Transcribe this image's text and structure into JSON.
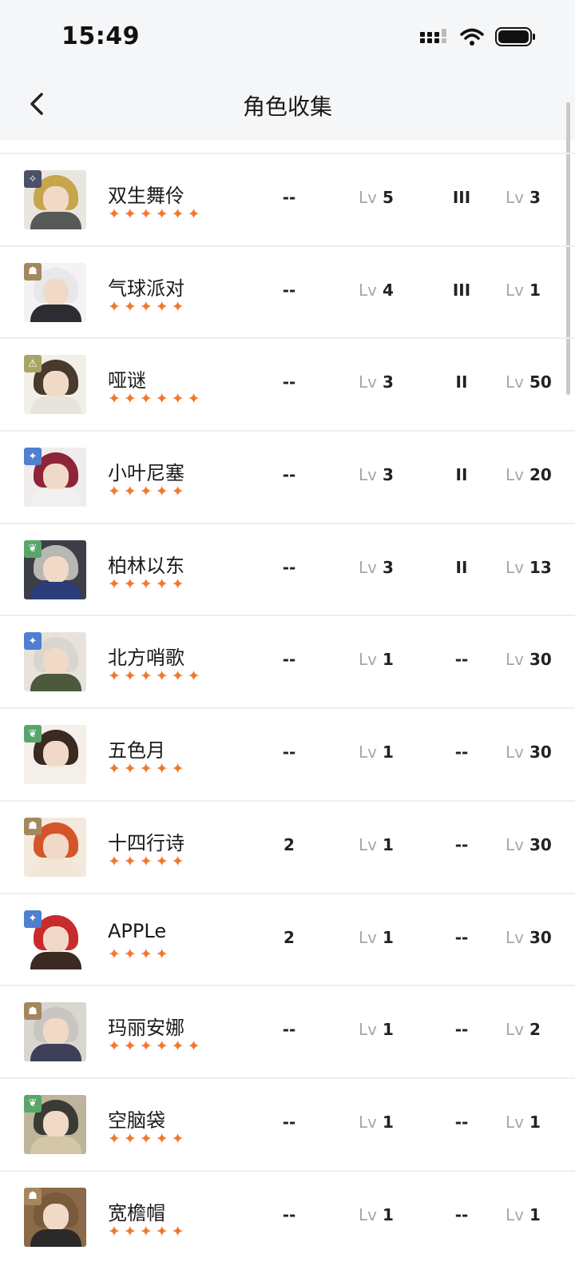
{
  "status_bar": {
    "time": "15:49"
  },
  "header": {
    "title": "角色收集"
  },
  "progress": 0.9,
  "characters": [
    {
      "name": "双生舞伶",
      "stars": "✦✦✦✦✦✦",
      "col1": "--",
      "lv_prefix": "Lv",
      "lv1": "5",
      "rank": "III",
      "lv2": "3",
      "badge_color": "#4a4f6a",
      "badge_glyph": "✧",
      "hair": "#c7a54a",
      "body": "#555a55",
      "bg": "#e9e6df"
    },
    {
      "name": "气球派对",
      "stars": "✦✦✦✦✦",
      "col1": "--",
      "lv_prefix": "Lv",
      "lv1": "4",
      "rank": "III",
      "lv2": "1",
      "badge_color": "#a5875e",
      "badge_glyph": "☗",
      "hair": "#e8e8ea",
      "body": "#2d2c33",
      "bg": "#f4f2f2"
    },
    {
      "name": "哑谜",
      "stars": "✦✦✦✦✦✦",
      "col1": "--",
      "lv_prefix": "Lv",
      "lv1": "3",
      "rank": "II",
      "lv2": "50",
      "badge_color": "#a9a464",
      "badge_glyph": "⚠",
      "hair": "#4a3a2e",
      "body": "#e8e4dd",
      "bg": "#f2eee8"
    },
    {
      "name": "小叶尼塞",
      "stars": "✦✦✦✦✦",
      "col1": "--",
      "lv_prefix": "Lv",
      "lv1": "3",
      "rank": "II",
      "lv2": "20",
      "badge_color": "#4f7fd0",
      "badge_glyph": "✦",
      "hair": "#8e2438",
      "body": "#f2f0ee",
      "bg": "#f0ecec"
    },
    {
      "name": "柏林以东",
      "stars": "✦✦✦✦✦",
      "col1": "--",
      "lv_prefix": "Lv",
      "lv1": "3",
      "rank": "II",
      "lv2": "13",
      "badge_color": "#5aa56a",
      "badge_glyph": "❦",
      "hair": "#b9b7b4",
      "body": "#2a3d7a",
      "bg": "#3c3f46"
    },
    {
      "name": "北方哨歌",
      "stars": "✦✦✦✦✦✦",
      "col1": "--",
      "lv_prefix": "Lv",
      "lv1": "1",
      "rank": "--",
      "lv2": "30",
      "badge_color": "#4f7fd0",
      "badge_glyph": "✦",
      "hair": "#d8d6cf",
      "body": "#4a5a3a",
      "bg": "#e7e3db"
    },
    {
      "name": "五色月",
      "stars": "✦✦✦✦✦",
      "col1": "--",
      "lv_prefix": "Lv",
      "lv1": "1",
      "rank": "--",
      "lv2": "30",
      "badge_color": "#5aa56a",
      "badge_glyph": "❦",
      "hair": "#3a2a22",
      "body": "#f3efea",
      "bg": "#f4efe9"
    },
    {
      "name": "十四行诗",
      "stars": "✦✦✦✦✦",
      "col1": "2",
      "lv_prefix": "Lv",
      "lv1": "1",
      "rank": "--",
      "lv2": "30",
      "badge_color": "#a5875e",
      "badge_glyph": "☗",
      "hair": "#d5552a",
      "body": "#f2e6d6",
      "bg": "#f4e9dd"
    },
    {
      "name": "APPLe",
      "stars": "✦✦✦✦",
      "col1": "2",
      "lv_prefix": "Lv",
      "lv1": "1",
      "rank": "--",
      "lv2": "30",
      "badge_color": "#4f7fd0",
      "badge_glyph": "✦",
      "hair": "#c82b2b",
      "body": "#3a2a22",
      "bg": "#ffffff"
    },
    {
      "name": "玛丽安娜",
      "stars": "✦✦✦✦✦✦",
      "col1": "--",
      "lv_prefix": "Lv",
      "lv1": "1",
      "rank": "--",
      "lv2": "2",
      "badge_color": "#a5875e",
      "badge_glyph": "☗",
      "hair": "#c9c6c2",
      "body": "#3e3f58",
      "bg": "#d9d6d2"
    },
    {
      "name": "空脑袋",
      "stars": "✦✦✦✦✦",
      "col1": "--",
      "lv_prefix": "Lv",
      "lv1": "1",
      "rank": "--",
      "lv2": "1",
      "badge_color": "#5aa56a",
      "badge_glyph": "❦",
      "hair": "#3b3b36",
      "body": "#d4c7a8",
      "bg": "#bdb49b"
    },
    {
      "name": "宽檐帽",
      "stars": "✦✦✦✦✦",
      "col1": "--",
      "lv_prefix": "Lv",
      "lv1": "1",
      "rank": "--",
      "lv2": "1",
      "badge_color": "#a5875e",
      "badge_glyph": "☗",
      "hair": "#7a5a3a",
      "body": "#2a2a2a",
      "bg": "#8a6a48"
    }
  ]
}
